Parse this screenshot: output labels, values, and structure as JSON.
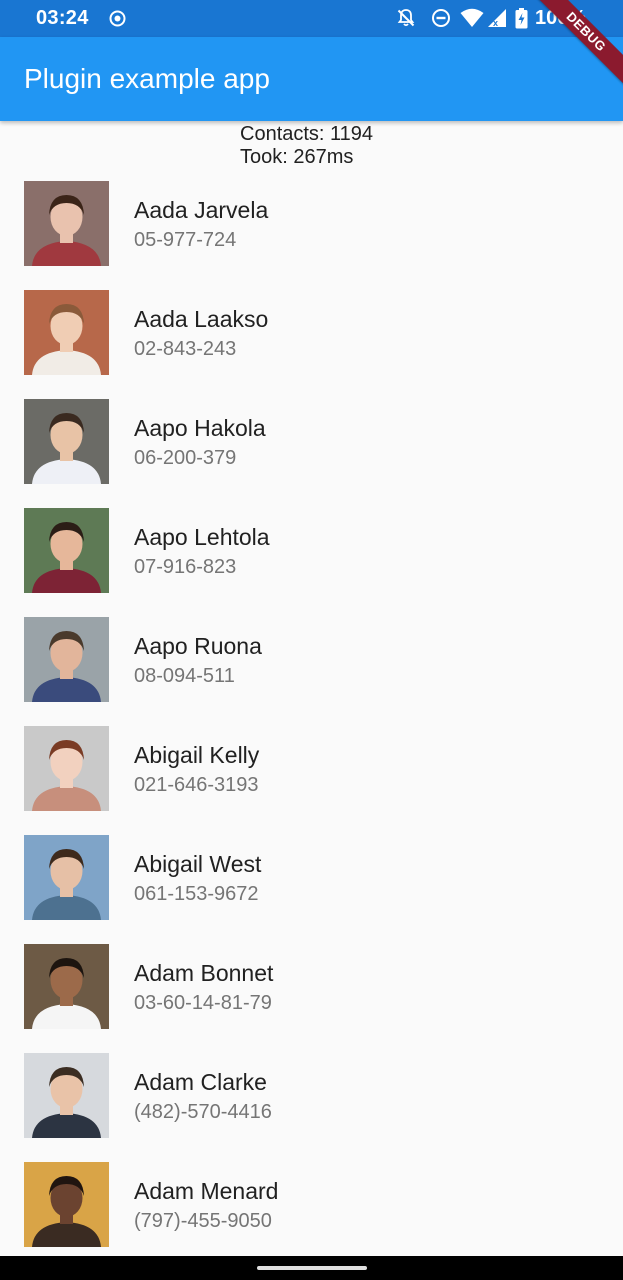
{
  "status_bar": {
    "time": "03:24",
    "battery": "100%"
  },
  "debug_banner": "DEBUG",
  "app_bar": {
    "title": "Plugin example app"
  },
  "summary": {
    "contacts": "Contacts: 1194",
    "took": "Took: 267ms"
  },
  "contacts": [
    {
      "name": "Aada Jarvela",
      "phone": "05-977-724",
      "bg": "#8a6f6a",
      "skin": "#e9c2ae",
      "hair": "#3b2418",
      "shirt": "#a0393f"
    },
    {
      "name": "Aada Laakso",
      "phone": "02-843-243",
      "bg": "#b7684a",
      "skin": "#f0cdb4",
      "hair": "#8a5a3a",
      "shirt": "#f1ece6"
    },
    {
      "name": "Aapo Hakola",
      "phone": "06-200-379",
      "bg": "#6b6b66",
      "skin": "#e8c3a6",
      "hair": "#3a2a20",
      "shirt": "#eef0f6"
    },
    {
      "name": "Aapo Lehtola",
      "phone": "07-916-823",
      "bg": "#5e7a55",
      "skin": "#e6b79a",
      "hair": "#2b1d16",
      "shirt": "#7d2335"
    },
    {
      "name": "Aapo Ruona",
      "phone": "08-094-511",
      "bg": "#9aa3a8",
      "skin": "#e2b59b",
      "hair": "#4a3a2c",
      "shirt": "#3a4b7c"
    },
    {
      "name": "Abigail Kelly",
      "phone": "021-646-3193",
      "bg": "#c9c9c9",
      "skin": "#f2d1bf",
      "hair": "#7a3b24",
      "shirt": "#c78f7c"
    },
    {
      "name": "Abigail West",
      "phone": "061-153-9672",
      "bg": "#7fa4c8",
      "skin": "#e6c0a6",
      "hair": "#3e2a1c",
      "shirt": "#4d7190"
    },
    {
      "name": "Adam Bonnet",
      "phone": "03-60-14-81-79",
      "bg": "#6d5a45",
      "skin": "#9c6a4a",
      "hair": "#1c140f",
      "shirt": "#f5f5f5"
    },
    {
      "name": "Adam Clarke",
      "phone": "(482)-570-4416",
      "bg": "#d6d9dd",
      "skin": "#e9c3a8",
      "hair": "#3b2d22",
      "shirt": "#2c3442"
    },
    {
      "name": "Adam Menard",
      "phone": "(797)-455-9050",
      "bg": "#d9a447",
      "skin": "#6b4330",
      "hair": "#201510",
      "shirt": "#3a2b22"
    }
  ]
}
